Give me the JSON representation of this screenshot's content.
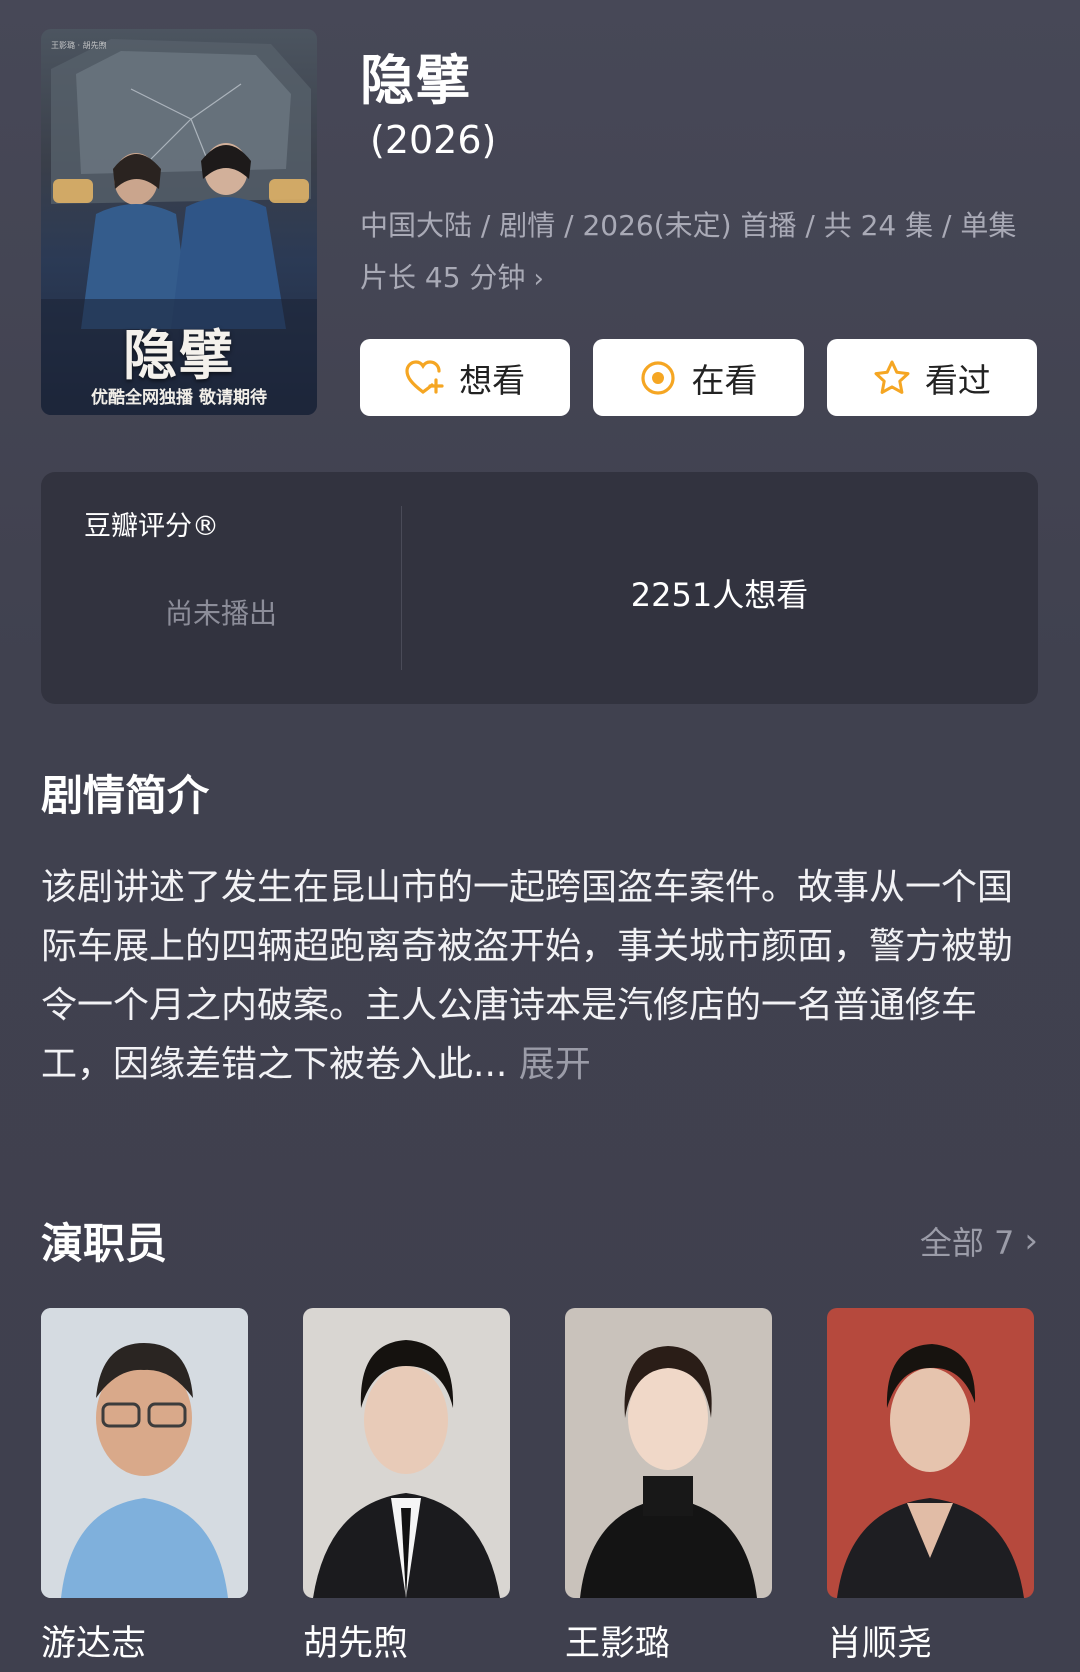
{
  "poster": {
    "title": "隐擘",
    "tagline": "优酷全网独播 敬请期待",
    "credit": "王影璐 · 胡先煦"
  },
  "show": {
    "title": "隐擘",
    "year": "(2026)",
    "meta": "中国大陆 / 剧情 / 2026(未定) 首播 / 共 24 集 / 单集片长 45 分钟"
  },
  "actions": [
    {
      "label": "想看",
      "icon": "heart-plus-icon"
    },
    {
      "label": "在看",
      "icon": "target-icon"
    },
    {
      "label": "看过",
      "icon": "star-icon"
    }
  ],
  "rating": {
    "label": "豆瓣评分®",
    "status": "尚未播出",
    "wish_count": "2251人想看"
  },
  "synopsis": {
    "heading": "剧情简介",
    "text": "该剧讲述了发生在昆山市的一起跨国盗车案件。故事从一个国际车展上的四辆超跑离奇被盗开始，事关城市颜面，警方被勒令一个月之内破案。主人公唐诗本是汽修店的一名普通修车工，因缘差错之下被卷入此...",
    "expand": "展开"
  },
  "cast": {
    "heading": "演职员",
    "all_label": "全部 7",
    "members": [
      {
        "name": "游达志"
      },
      {
        "name": "胡先煦"
      },
      {
        "name": "王影璐"
      },
      {
        "name": "肖顺尧"
      }
    ]
  },
  "colors": {
    "background": "#40414f",
    "card": "#32333f",
    "accent": "#f5a623",
    "muted": "#a9aab6"
  }
}
